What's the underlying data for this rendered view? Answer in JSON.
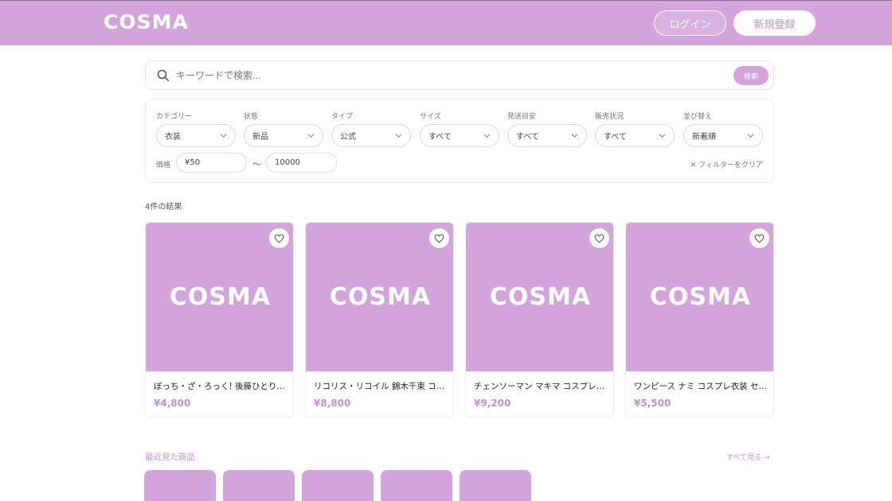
{
  "header": {
    "logo": "COSMA",
    "login_label": "ログイン",
    "register_label": "新規登録"
  },
  "search": {
    "placeholder": "キーワードで検索...",
    "button_label": "検索"
  },
  "filters": {
    "category": {
      "label": "カテゴリー",
      "value": "衣装"
    },
    "condition": {
      "label": "状態",
      "value": "新品"
    },
    "type": {
      "label": "タイプ",
      "value": "公式"
    },
    "size": {
      "label": "サイズ",
      "value": "すべて"
    },
    "shipping": {
      "label": "発送目安",
      "value": "すべて"
    },
    "sale_status": {
      "label": "販売状況",
      "value": "すべて"
    },
    "sort": {
      "label": "並び替え",
      "value": "新着順"
    },
    "price": {
      "label": "価格",
      "min": "¥50",
      "separator": "〜",
      "max": "10000"
    },
    "clear_label": "✕ フィルターをクリア"
  },
  "results": {
    "count_label": "4件の結果",
    "items": [
      {
        "title": "ぼっち・ざ・ろっく! 後藤ひとり コスプレ衣装",
        "price": "¥4,800",
        "image_text": "COSMA"
      },
      {
        "title": "リコリス・リコイル 錦木千束 コスプレ衣装",
        "price": "¥8,800",
        "image_text": "COSMA"
      },
      {
        "title": "チェンソーマン マキマ コスプレ衣装",
        "price": "¥9,200",
        "image_text": "COSMA"
      },
      {
        "title": "ワンピース ナミ コスプレ衣装 セット",
        "price": "¥5,500",
        "image_text": "COSMA"
      }
    ]
  },
  "recent": {
    "title": "最近見た商品",
    "see_all_label": "すべて見る →"
  },
  "colors": {
    "brand": "#d4a5dc",
    "accent_text": "#c48fce"
  },
  "icons": {
    "search": "search-icon",
    "chevron": "chevron-down-icon",
    "favorite": "heart-icon"
  }
}
